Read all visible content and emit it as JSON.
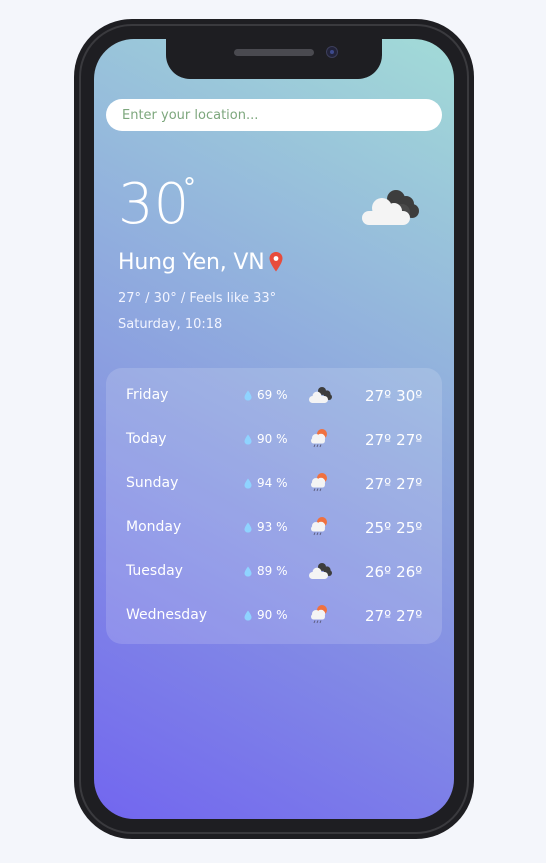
{
  "search": {
    "placeholder": "Enter your location..."
  },
  "current": {
    "temperature": "30",
    "degree_symbol": "°",
    "location": "Hung Yen, VN",
    "range_feels": "27° / 30° / Feels like 33°",
    "datetime": "Saturday, 10:18",
    "icon": "dark-clouds-icon"
  },
  "forecast": [
    {
      "day": "Friday",
      "humidity": "69 %",
      "icon": "dark-clouds-icon",
      "min": "27º",
      "max": "30º"
    },
    {
      "day": "Today",
      "humidity": "90 %",
      "icon": "sun-rain-icon",
      "min": "27º",
      "max": "27º"
    },
    {
      "day": "Sunday",
      "humidity": "94 %",
      "icon": "sun-rain-icon",
      "min": "27º",
      "max": "27º"
    },
    {
      "day": "Monday",
      "humidity": "93 %",
      "icon": "sun-rain-icon",
      "min": "25º",
      "max": "25º"
    },
    {
      "day": "Tuesday",
      "humidity": "89 %",
      "icon": "dark-clouds-icon",
      "min": "26º",
      "max": "26º"
    },
    {
      "day": "Wednesday",
      "humidity": "90 %",
      "icon": "sun-rain-icon",
      "min": "27º",
      "max": "27º"
    }
  ],
  "colors": {
    "gradient_bottom": "#7266ef",
    "gradient_top": "#a2dbd7",
    "pin": "#e74c3c",
    "sun": "#f0713f",
    "drop": "#8fd3ff"
  }
}
